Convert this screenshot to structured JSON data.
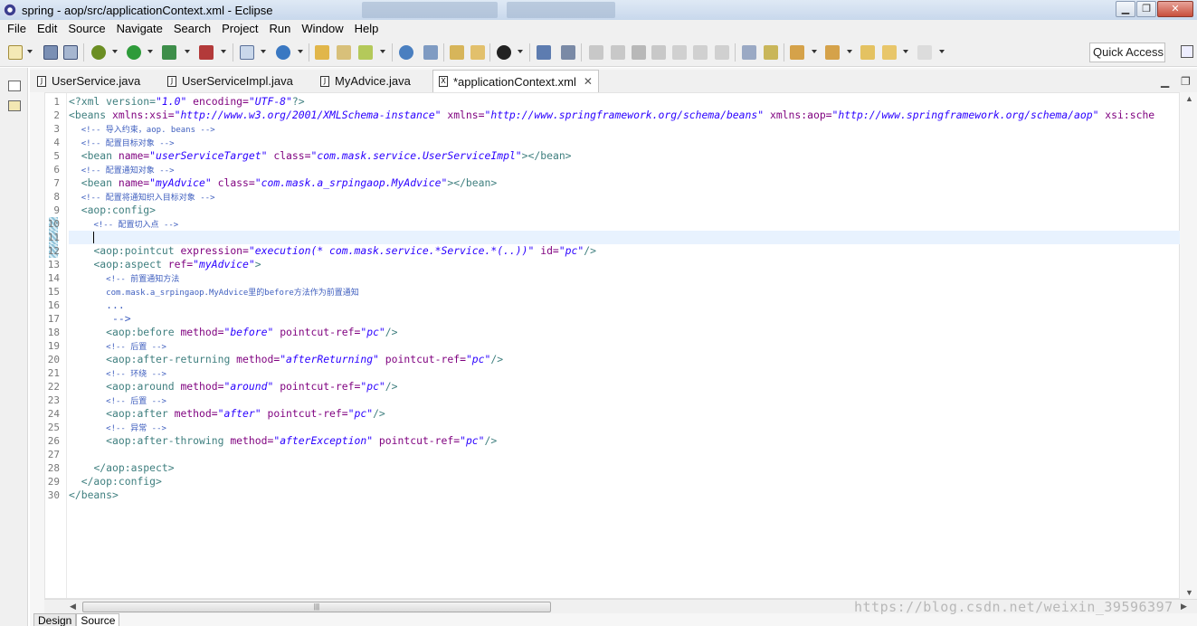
{
  "window": {
    "title": "spring - aop/src/applicationContext.xml - Eclipse",
    "controls": [
      "▁",
      "❐",
      "✕"
    ]
  },
  "menu": [
    "File",
    "Edit",
    "Source",
    "Navigate",
    "Search",
    "Project",
    "Run",
    "Window",
    "Help"
  ],
  "toolbar": {
    "quick_access": "Quick Access"
  },
  "editor_tabs": [
    {
      "label": "UserService.java",
      "icon": "J"
    },
    {
      "label": "UserServiceImpl.java",
      "icon": "J"
    },
    {
      "label": "MyAdvice.java",
      "icon": "J"
    },
    {
      "label": "*applicationContext.xml",
      "icon": "X",
      "active": true
    }
  ],
  "tab_close": "✕",
  "code": {
    "l1_decl_open": "<?xml version=",
    "l1_ver": "\"1.0\"",
    "l1_enc_attr": " encoding=",
    "l1_enc": "\"UTF-8\"",
    "l1_close": "?>",
    "l2_open": "<beans",
    "l2_a1": " xmlns:xsi=",
    "l2_v1": "\"http://www.w3.org/2001/XMLSchema-instance\"",
    "l2_a2": " xmlns=",
    "l2_v2": "\"http://www.springframework.org/schema/beans\"",
    "l2_a3": " xmlns:aop=",
    "l2_v3": "\"http://www.springframework.org/schema/aop\"",
    "l2_a4": " xsi:sche",
    "l3": "<!-- 导入约束，aop. beans -->",
    "l4": "<!-- 配置目标对象 -->",
    "l5_open": "<bean",
    "l5_a1": " name=",
    "l5_v1": "\"userServiceTarget\"",
    "l5_a2": " class=",
    "l5_v2": "\"com.mask.service.UserServiceImpl\"",
    "l5_close": "></bean>",
    "l6": "<!-- 配置通知对象 -->",
    "l7_open": "<bean",
    "l7_a1": " name=",
    "l7_v1": "\"myAdvice\"",
    "l7_a2": " class=",
    "l7_v2": "\"com.mask.a_srpingaop.MyAdvice\"",
    "l7_close": "></bean>",
    "l8": "<!-- 配置将通知织入目标对象 -->",
    "l9": "<aop:config>",
    "l10": "<!-- 配置切入点 -->",
    "l12_open": "<aop:pointcut",
    "l12_a1": " expression=",
    "l12_v1": "\"execution(* com.mask.service.*Service.*(..))\"",
    "l12_a2": " id=",
    "l12_v2": "\"pc\"",
    "l12_close": "/>",
    "l13_open": "<aop:aspect",
    "l13_a1": " ref=",
    "l13_v1": "\"myAdvice\"",
    "l13_close": ">",
    "l14": "<!-- 前置通知方法",
    "l15": "com.mask.a_srpingaop.MyAdvice里的before方法作为前置通知",
    "l16": "...",
    "l17": " -->",
    "l18_open": "<aop:before",
    "l18_a1": " method=",
    "l18_v1": "\"before\"",
    "l18_a2": " pointcut-ref=",
    "l18_v2": "\"pc\"",
    "l18_close": "/>",
    "l19": "<!-- 后置 -->",
    "l20_open": "<aop:after-returning",
    "l20_a1": " method=",
    "l20_v1": "\"afterReturning\"",
    "l20_a2": " pointcut-ref=",
    "l20_v2": "\"pc\"",
    "l20_close": "/>",
    "l21": "<!-- 环绕 -->",
    "l22_open": "<aop:around",
    "l22_a1": " method=",
    "l22_v1": "\"around\"",
    "l22_a2": " pointcut-ref=",
    "l22_v2": "\"pc\"",
    "l22_close": "/>",
    "l23": "<!-- 后置 -->",
    "l24_open": "<aop:after",
    "l24_a1": " method=",
    "l24_v1": "\"after\"",
    "l24_a2": " pointcut-ref=",
    "l24_v2": "\"pc\"",
    "l24_close": "/>",
    "l25": "<!-- 异常 -->",
    "l26_open": "<aop:after-throwing",
    "l26_a1": " method=",
    "l26_v1": "\"afterException\"",
    "l26_a2": " pointcut-ref=",
    "l26_v2": "\"pc\"",
    "l26_close": "/>",
    "l28": "</aop:aspect>",
    "l29": "</aop:config>",
    "l30": "</beans>"
  },
  "line_numbers": [
    "1",
    "2",
    "3",
    "4",
    "5",
    "6",
    "7",
    "8",
    "9",
    "10",
    "11",
    "12",
    "13",
    "14",
    "15",
    "16",
    "17",
    "18",
    "19",
    "20",
    "21",
    "22",
    "23",
    "24",
    "25",
    "26",
    "27",
    "28",
    "29",
    "30"
  ],
  "scroll_grip": "|||",
  "watermark": "https://blog.csdn.net/weixin_39596397",
  "bottom_tabs": [
    "Design",
    "Source"
  ],
  "colors": {
    "tag": "#3f7f7f",
    "attribute": "#7f007f",
    "string": "#2a00ff",
    "comment": "#3f5fbf",
    "current_line": "#e8f2fe"
  }
}
